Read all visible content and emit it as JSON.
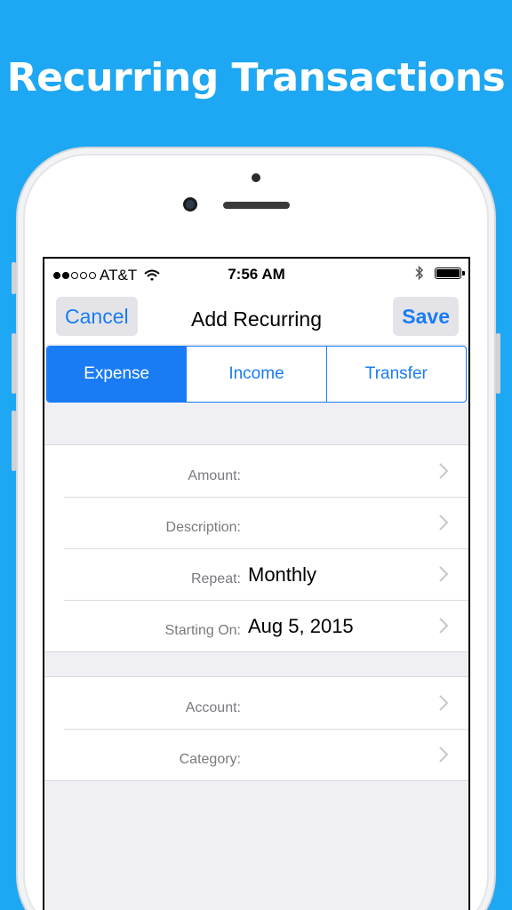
{
  "headline": "Recurring Transactions",
  "status_bar": {
    "carrier": "AT&T",
    "time": "7:56 AM",
    "signal_dots_filled": 2,
    "signal_dots_total": 5,
    "icons": [
      "wifi-icon",
      "bluetooth-icon",
      "battery-icon"
    ]
  },
  "nav": {
    "cancel_label": "Cancel",
    "title": "Add Recurring",
    "save_label": "Save"
  },
  "segments": [
    {
      "label": "Expense",
      "selected": true
    },
    {
      "label": "Income",
      "selected": false
    },
    {
      "label": "Transfer",
      "selected": false
    }
  ],
  "form_group_1": [
    {
      "label": "Amount:",
      "value": ""
    },
    {
      "label": "Description:",
      "value": ""
    },
    {
      "label": "Repeat:",
      "value": "Monthly"
    },
    {
      "label": "Starting On:",
      "value": "Aug 5, 2015"
    }
  ],
  "form_group_2": [
    {
      "label": "Account:",
      "value": ""
    },
    {
      "label": "Category:",
      "value": ""
    }
  ],
  "colors": {
    "background": "#1ea7f2",
    "accent": "#1a7cf5",
    "table_background": "#efeff4"
  }
}
